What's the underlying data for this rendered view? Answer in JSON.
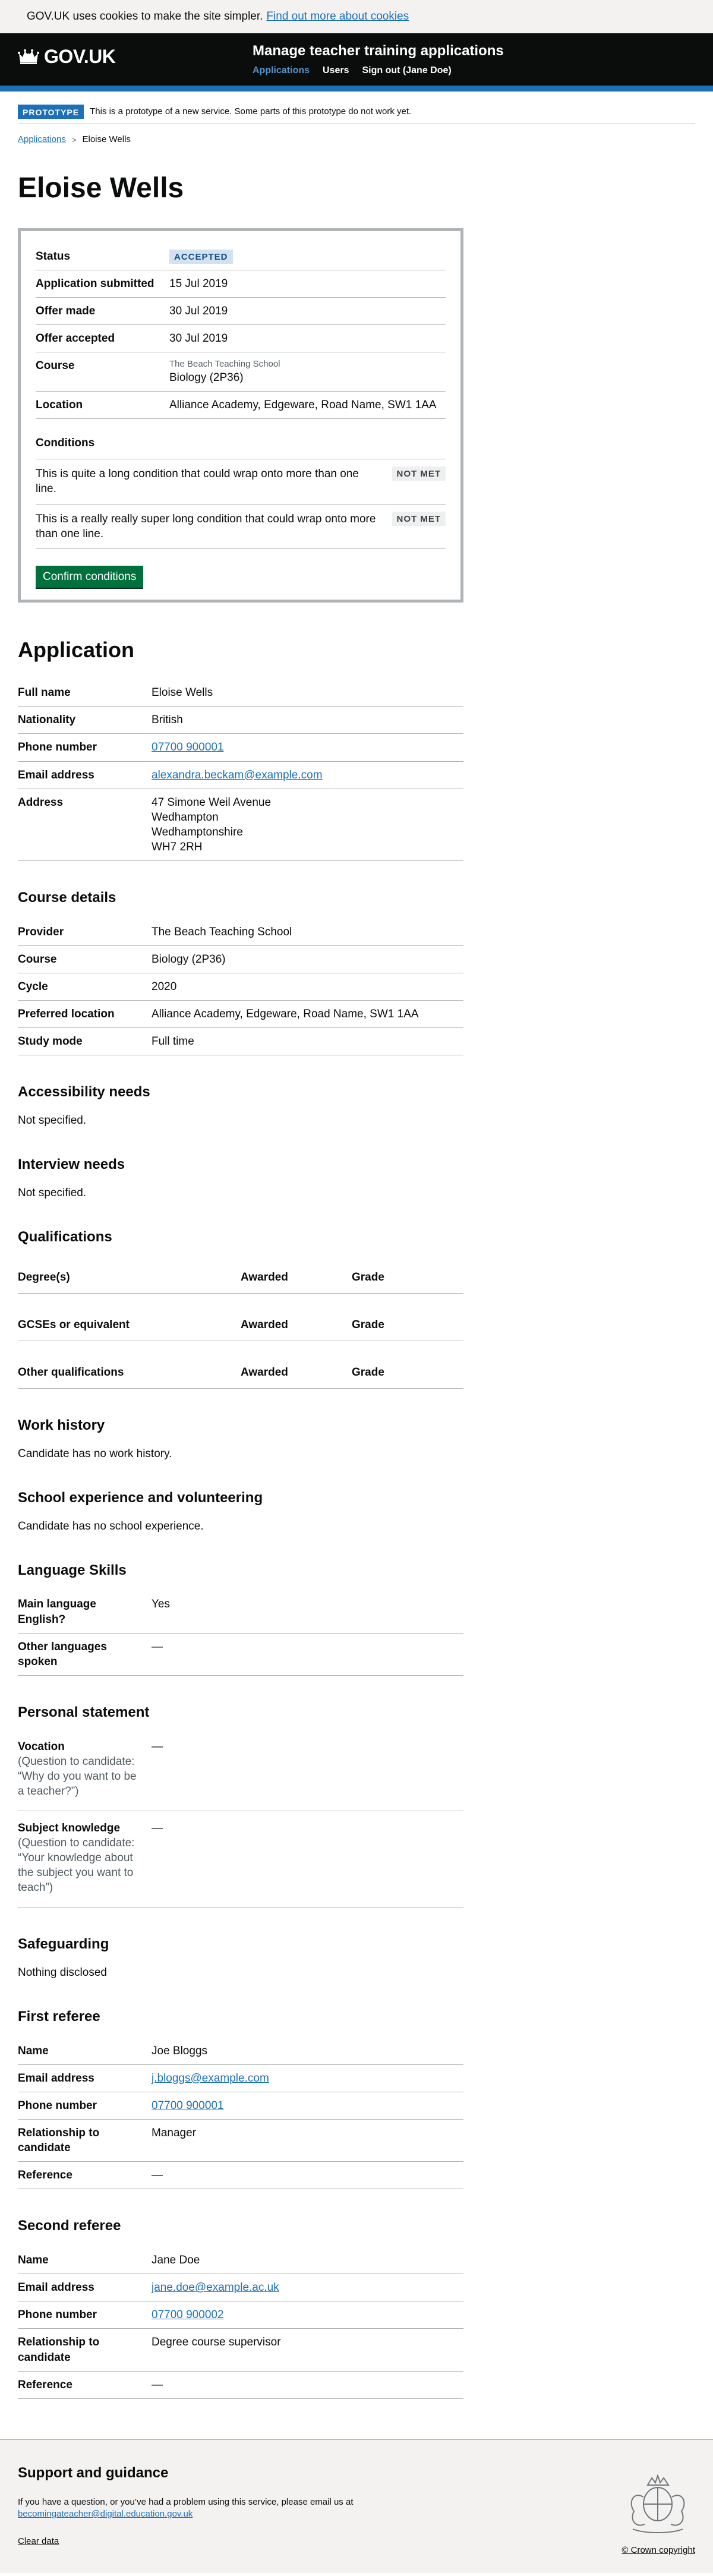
{
  "cookie": {
    "message": "GOV.UK uses cookies to make the site simpler.",
    "link": "Find out more about cookies"
  },
  "header": {
    "logo": "GOV.UK",
    "service_name": "Manage teacher training applications",
    "nav": [
      "Applications",
      "Users",
      "Sign out (Jane Doe)"
    ]
  },
  "phase": {
    "tag": "PROTOTYPE",
    "text": "This is a prototype of a new service. Some parts of this prototype do not work yet."
  },
  "breadcrumb": [
    "Applications",
    "Eloise Wells"
  ],
  "page_title": "Eloise Wells",
  "status_panel": {
    "status_label": "Status",
    "status_tag": "ACCEPTED",
    "rows": [
      {
        "key": "Application submitted",
        "value": "15 Jul 2019"
      },
      {
        "key": "Offer made",
        "value": "30 Jul 2019"
      },
      {
        "key": "Offer accepted",
        "value": "30 Jul 2019"
      }
    ],
    "course_label": "Course",
    "course_provider": "The Beach Teaching School",
    "course_name": "Biology (2P36)",
    "location_label": "Location",
    "location_value": "Alliance Academy, Edgeware, Road Name, SW1 1AA",
    "conditions_heading": "Conditions",
    "conditions": [
      {
        "text": "This is quite a long condition that could wrap onto more than one line.",
        "status": "NOT MET"
      },
      {
        "text": "This is a really really super long condition that could wrap onto more than one line.",
        "status": "NOT MET"
      }
    ],
    "confirm_button": "Confirm conditions"
  },
  "application": {
    "heading": "Application",
    "full_name_label": "Full name",
    "full_name": "Eloise Wells",
    "nationality_label": "Nationality",
    "nationality": "British",
    "phone_label": "Phone number",
    "phone": "07700 900001",
    "email_label": "Email address",
    "email": "alexandra.beckam@example.com",
    "address_label": "Address",
    "address": [
      "47 Simone Weil Avenue",
      "Wedhampton",
      "Wedhamptonshire",
      "WH7 2RH"
    ]
  },
  "course_details": {
    "heading": "Course details",
    "rows": [
      {
        "key": "Provider",
        "value": "The Beach Teaching School"
      },
      {
        "key": "Course",
        "value": "Biology (2P36)"
      },
      {
        "key": "Cycle",
        "value": "2020"
      },
      {
        "key": "Preferred location",
        "value": "Alliance Academy, Edgeware, Road Name, SW1 1AA"
      },
      {
        "key": "Study mode",
        "value": "Full time"
      }
    ]
  },
  "accessibility": {
    "heading": "Accessibility needs",
    "text": "Not specified."
  },
  "interview": {
    "heading": "Interview needs",
    "text": "Not specified."
  },
  "qualifications": {
    "heading": "Qualifications",
    "rows": [
      {
        "name": "Degree(s)",
        "awarded": "Awarded",
        "grade": "Grade"
      },
      {
        "name": "GCSEs or equivalent",
        "awarded": "Awarded",
        "grade": "Grade"
      },
      {
        "name": "Other qualifications",
        "awarded": "Awarded",
        "grade": "Grade"
      }
    ]
  },
  "work_history": {
    "heading": "Work history",
    "text": "Candidate has no work history."
  },
  "school_experience": {
    "heading": "School experience and volunteering",
    "text": "Candidate has no school experience."
  },
  "language": {
    "heading": "Language Skills",
    "rows": [
      {
        "key": "Main language English?",
        "value": "Yes"
      },
      {
        "key": "Other languages spoken",
        "value": "—"
      }
    ]
  },
  "personal_statement": {
    "heading": "Personal statement",
    "vocation_label": "Vocation",
    "vocation_hint": "(Question to candidate: “Why do you want to be a teacher?”)",
    "vocation_value": "—",
    "subject_label": "Subject knowledge",
    "subject_hint": "(Question to candidate: “Your knowledge about the subject you want to teach”)",
    "subject_value": "—"
  },
  "safeguarding": {
    "heading": "Safeguarding",
    "text": "Nothing disclosed"
  },
  "first_referee": {
    "heading": "First referee",
    "name_label": "Name",
    "name": "Joe Bloggs",
    "email_label": "Email address",
    "email": "j.bloggs@example.com",
    "phone_label": "Phone number",
    "phone": "07700 900001",
    "relationship_label": "Relationship to candidate",
    "relationship": "Manager",
    "reference_label": "Reference",
    "reference": "—"
  },
  "second_referee": {
    "heading": "Second referee",
    "name_label": "Name",
    "name": "Jane Doe",
    "email_label": "Email address",
    "email": "jane.doe@example.ac.uk",
    "phone_label": "Phone number",
    "phone": "07700 900002",
    "relationship_label": "Relationship to candidate",
    "relationship": "Degree course supervisor",
    "reference_label": "Reference",
    "reference": "—"
  },
  "footer": {
    "heading": "Support and guidance",
    "text": "If you have a question, or you’ve had a problem using this service, please email us at",
    "email": "becomingateacher@digital.education.gov.uk",
    "clear_data": "Clear data",
    "copyright": "© Crown copyright"
  },
  "colors": {
    "brand_blue": "#1d70b8",
    "button_green": "#00703c",
    "header_black": "#0b0c0c"
  }
}
